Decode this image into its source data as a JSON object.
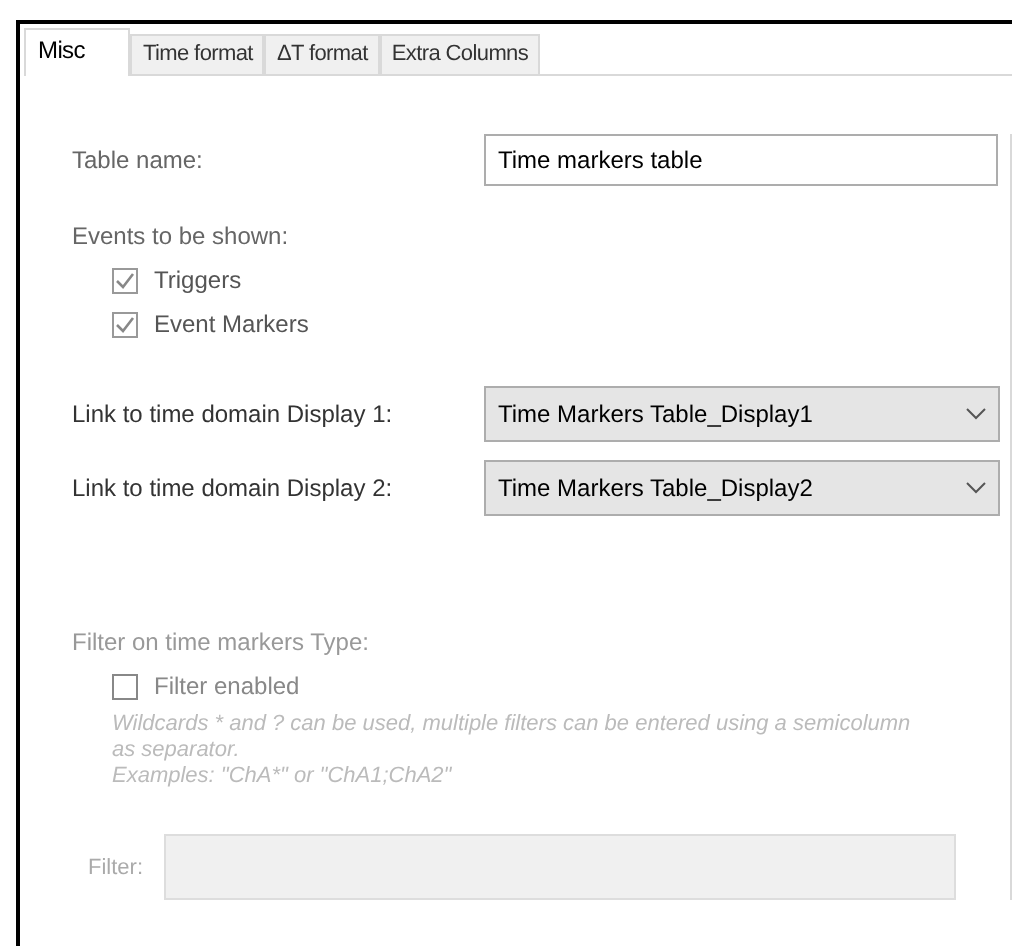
{
  "tabs": [
    {
      "label": "Misc",
      "selected": true
    },
    {
      "label": "Time format",
      "selected": false
    },
    {
      "label": "ΔT format",
      "selected": false
    },
    {
      "label": "Extra Columns",
      "selected": false
    }
  ],
  "table_name": {
    "label": "Table name:",
    "value": "Time markers table"
  },
  "events": {
    "label": "Events to be shown:",
    "items": [
      {
        "label": "Triggers",
        "checked": true
      },
      {
        "label": "Event Markers",
        "checked": true
      }
    ]
  },
  "links": [
    {
      "label": "Link to time domain Display 1:",
      "value": "Time Markers Table_Display1"
    },
    {
      "label": "Link to time domain Display 2:",
      "value": "Time Markers Table_Display2"
    }
  ],
  "filter": {
    "heading": "Filter on time markers Type:",
    "disabled": true,
    "checkbox": {
      "label": "Filter enabled",
      "checked": false
    },
    "hint": [
      "Wildcards * and ? can be used, multiple filters can be entered using a semicolumn as separator.",
      "Examples: \"ChA*\" or  \"ChA1;ChA2\""
    ],
    "field_label": "Filter:"
  }
}
